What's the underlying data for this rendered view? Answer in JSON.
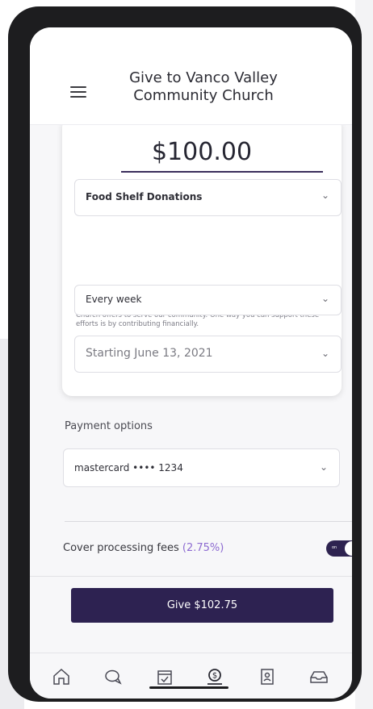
{
  "header": {
    "title": "Give to Vanco Valley Community Church"
  },
  "donation": {
    "amount": "$100.00",
    "fund": "Food Shelf Donations",
    "description": "Our food shelf is one of the many resources Vanco Valley Community Church offers to serve our community. One way you can support these efforts is by contributing financially.",
    "frequency": "Every week",
    "start": "Starting June 13, 2021"
  },
  "payment": {
    "label": "Payment options",
    "method": "mastercard •••• 1234"
  },
  "fees": {
    "label": "Cover processing fees",
    "percent": "(2.75%)",
    "toggle_text": "on",
    "enabled": true
  },
  "give_button": "Give $102.75",
  "tabs": [
    {
      "icon": "home-icon"
    },
    {
      "icon": "chat-icon"
    },
    {
      "icon": "calendar-icon"
    },
    {
      "icon": "give-icon"
    },
    {
      "icon": "directory-icon"
    },
    {
      "icon": "inbox-icon"
    }
  ],
  "colors": {
    "primary": "#2d2251",
    "accent": "#8d6bd1"
  }
}
